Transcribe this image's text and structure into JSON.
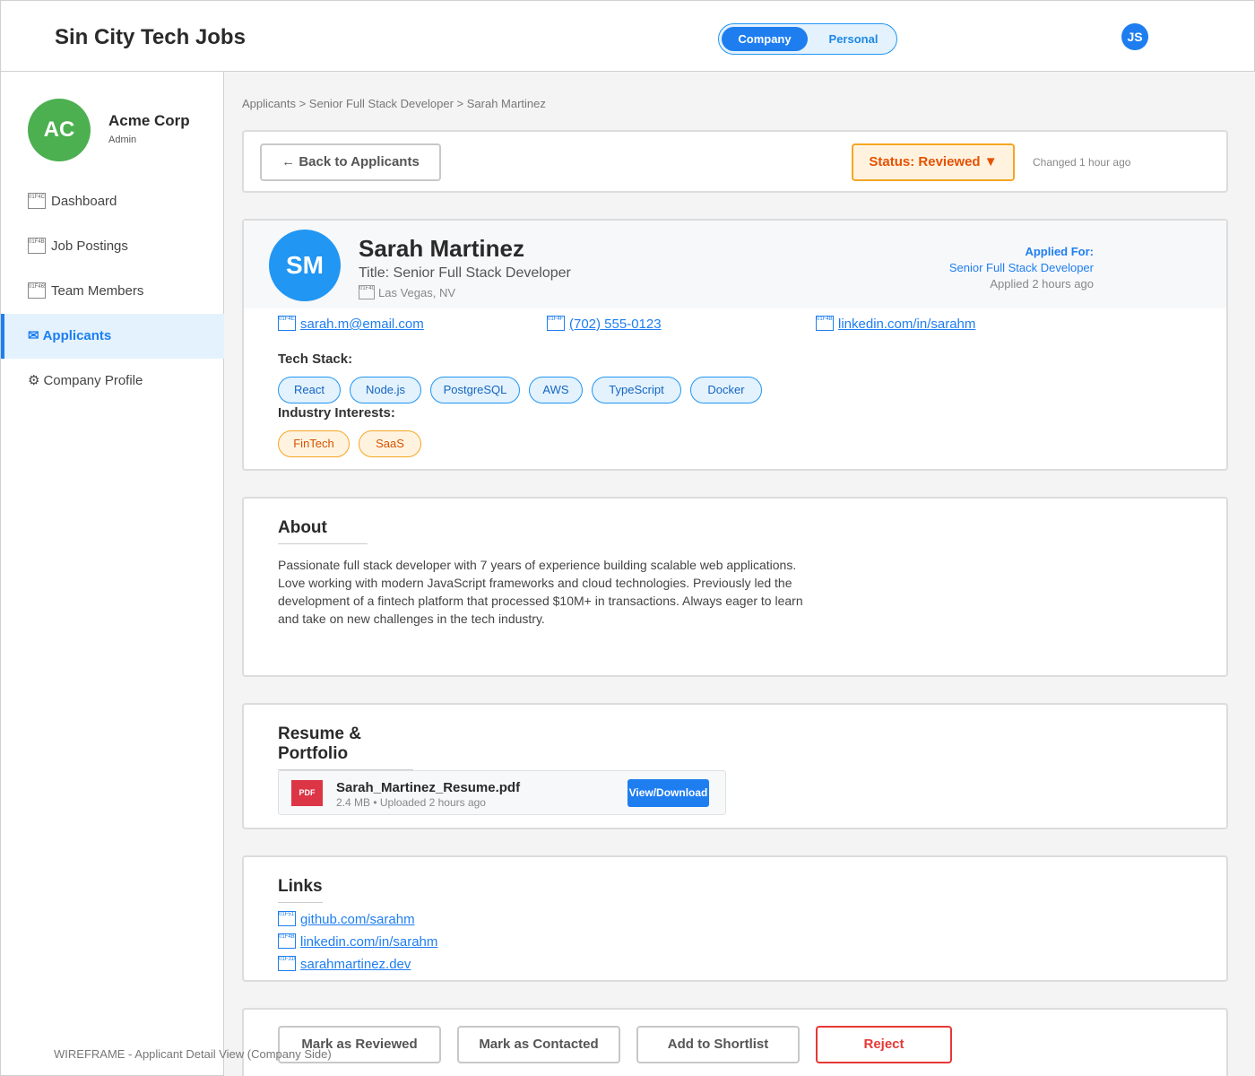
{
  "header": {
    "brand": "Sin City Tech Jobs",
    "toggle": {
      "company": "Company",
      "personal": "Personal",
      "selected": "Company"
    },
    "user_initials": "JS"
  },
  "sidebar": {
    "org": {
      "initials": "AC",
      "name": "Acme Corp",
      "role": "Admin"
    },
    "items": [
      {
        "label": "Dashboard",
        "icon": "chart-icon",
        "glyph": "01F4CA"
      },
      {
        "label": "Job Postings",
        "icon": "briefcase-icon",
        "glyph": "01F4BC"
      },
      {
        "label": "Team Members",
        "icon": "people-icon",
        "glyph": "01F465"
      },
      {
        "label": "Applicants",
        "icon": "envelope-icon",
        "symbol": "✉",
        "active": true
      },
      {
        "label": "Company Profile",
        "icon": "gear-icon",
        "symbol": "⚙"
      }
    ]
  },
  "breadcrumb": "Applicants > Senior Full Stack Developer > Sarah Martinez",
  "actions_bar": {
    "back_label": "← Back to Applicants",
    "status_label": "Status: Reviewed ▼",
    "changed": "Changed 1 hour ago"
  },
  "candidate": {
    "initials": "SM",
    "name": "Sarah Martinez",
    "title": "Title: Senior Full Stack Developer",
    "location": "Las Vegas, NV",
    "location_glyph": "01F4CD",
    "applied_for_label": "Applied For:",
    "applied_for_role": "Senior Full Stack Developer",
    "applied_time": "Applied 2 hours ago",
    "contacts": {
      "email": "sarah.m@email.com",
      "email_glyph": "01F4E7",
      "phone": "(702) 555-0123",
      "phone_glyph": "01F4F1",
      "linkedin": "linkedin.com/in/sarahm",
      "linkedin_glyph": "01F4BC"
    },
    "tech_stack_label": "Tech Stack:",
    "tech_stack": [
      "React",
      "Node.js",
      "PostgreSQL",
      "AWS",
      "TypeScript",
      "Docker"
    ],
    "interests_label": "Industry Interests:",
    "interests": [
      "FinTech",
      "SaaS"
    ]
  },
  "about": {
    "title": "About",
    "text": "Passionate full stack developer with 7 years of experience building scalable web applications. Love working with modern JavaScript frameworks and cloud technologies. Previously led the development of a fintech platform that processed $10M+ in transactions. Always eager to learn and take on new challenges in the tech industry."
  },
  "resume": {
    "title": "Resume & Portfolio",
    "file_type": "PDF",
    "file_name": "Sarah_Martinez_Resume.pdf",
    "file_meta": "2.4 MB • Uploaded 2 hours ago",
    "download_label": "View/Download"
  },
  "links": {
    "title": "Links",
    "items": [
      {
        "text": "github.com/sarahm",
        "glyph": "01F517"
      },
      {
        "text": "linkedin.com/in/sarahm",
        "glyph": "01F4BC"
      },
      {
        "text": "sarahmartinez.dev",
        "glyph": "01F310"
      }
    ]
  },
  "bottom_actions": {
    "mark_reviewed": "Mark as Reviewed",
    "mark_contacted": "Mark as Contacted",
    "shortlist": "Add to Shortlist",
    "reject": "Reject"
  },
  "footer_note": "WIREFRAME - Applicant Detail View (Company Side)",
  "colors": {
    "accent": "#1e7ef0",
    "org_avatar": "#4caf50",
    "candidate_avatar": "#2196f3",
    "status": "#f5a623",
    "reject": "#e53935",
    "pdf": "#dc3545"
  }
}
